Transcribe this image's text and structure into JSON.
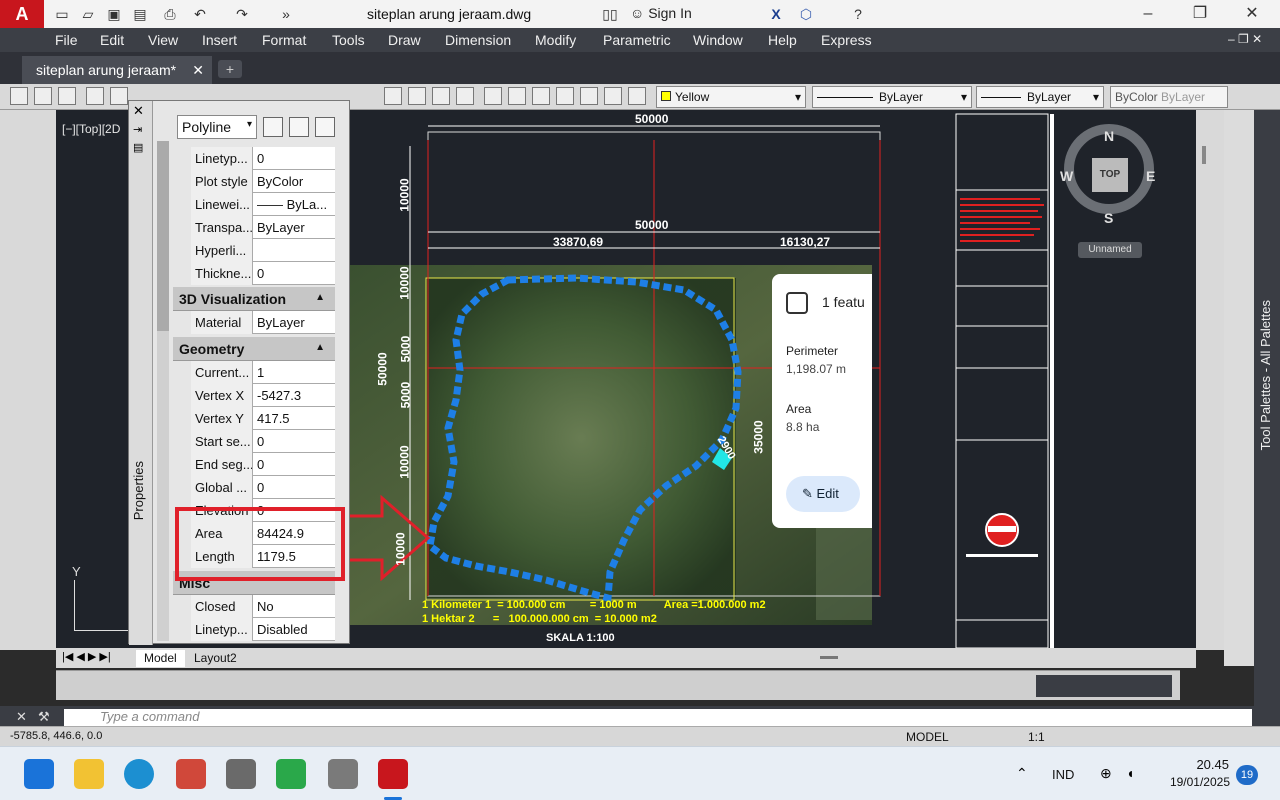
{
  "window": {
    "title": "siteplan arung jeraam.dwg",
    "signin_label": "Sign In",
    "app_logo": "A"
  },
  "menu": [
    "File",
    "Edit",
    "View",
    "Insert",
    "Format",
    "Tools",
    "Draw",
    "Dimension",
    "Modify",
    "Parametric",
    "Window",
    "Help",
    "Express"
  ],
  "tabs": {
    "file_tab": "siteplan arung jeraam*",
    "add_tab": "+"
  },
  "toolbar": {
    "color_dropdown": "Yellow",
    "linetype_dropdown": "ByLayer",
    "lineweight_dropdown": "ByLayer",
    "plotstyle_dropdown": "ByColor",
    "plotstyle_faded": "ByLayer"
  },
  "viewport": {
    "label": "[−][Top][2D"
  },
  "properties": {
    "object_type": "Polyline",
    "palette_title": "Properties",
    "rows_general": [
      {
        "key": "Linetyp...",
        "value": "0"
      },
      {
        "key": "Plot style",
        "value": "ByColor"
      },
      {
        "key": "Linewei...",
        "value": "—— ByLa..."
      },
      {
        "key": "Transpa...",
        "value": "ByLayer"
      },
      {
        "key": "Hyperli...",
        "value": ""
      },
      {
        "key": "Thickne...",
        "value": "0"
      }
    ],
    "section_3d": "3D Visualization",
    "rows_3d": [
      {
        "key": "Material",
        "value": "ByLayer"
      }
    ],
    "section_geometry": "Geometry",
    "rows_geometry": [
      {
        "key": "Current...",
        "value": "1"
      },
      {
        "key": "Vertex X",
        "value": "-5427.3"
      },
      {
        "key": "Vertex Y",
        "value": "417.5"
      },
      {
        "key": "Start se...",
        "value": "0"
      },
      {
        "key": "End seg...",
        "value": "0"
      },
      {
        "key": "Global ...",
        "value": "0"
      },
      {
        "key": "Elevation",
        "value": "0"
      },
      {
        "key": "Area",
        "value": "84424.9"
      },
      {
        "key": "Length",
        "value": "1179.5"
      }
    ],
    "section_misc": "Misc",
    "rows_misc": [
      {
        "key": "Closed",
        "value": "No"
      },
      {
        "key": "Linetyp...",
        "value": "Disabled"
      }
    ]
  },
  "drawing": {
    "dim_top": "50000",
    "dim_mid": "50000",
    "dim_left_part": "33870,69",
    "dim_right_part": "16130,27",
    "dim_v_10000_top": "10000",
    "dim_v_10000_b": "10000",
    "dim_v_50000": "50000",
    "dim_v_5000_a": "5000",
    "dim_v_5000_b": "5000",
    "dim_v_10000_c": "10000",
    "dim_v_10000_d": "10000",
    "dim_v_35000": "35000",
    "dim_small": "2900",
    "legend_line1": "1 Kilometer 1  = 100.000 cm        = 1000 m         Area =1.000.000 m2",
    "legend_line2": "1 Hektar 2      =   100.000.000 cm  = 10.000 m2",
    "scale_label": "SKALA 1:100",
    "feature_card": {
      "title": "1 featu",
      "perimeter_label": "Perimeter",
      "perimeter_value": "1,198.07 m",
      "area_label": "Area",
      "area_value": "8.8 ha",
      "edit_label": "Edit"
    }
  },
  "viewcube": {
    "north": "N",
    "south": "S",
    "east": "E",
    "west": "W",
    "top": "TOP",
    "unnamed": "Unnamed"
  },
  "tool_palette_title": "Tool Palettes - All Palettes",
  "layout_tabs": [
    "Model",
    "Layout2"
  ],
  "command": {
    "placeholder": "Type a command"
  },
  "status": {
    "coords": "-5785.8, 446.6, 0.0",
    "model": "MODEL",
    "scale": "1:1"
  },
  "taskbar": {
    "language": "IND",
    "time": "20.45",
    "date": "19/01/2025",
    "notifications": "19"
  },
  "colors": {
    "highlight_red": "#e0202a",
    "polyline_blue": "#1e7fe6",
    "dim_white": "#ffffff",
    "yellow_text": "#ffff00"
  }
}
